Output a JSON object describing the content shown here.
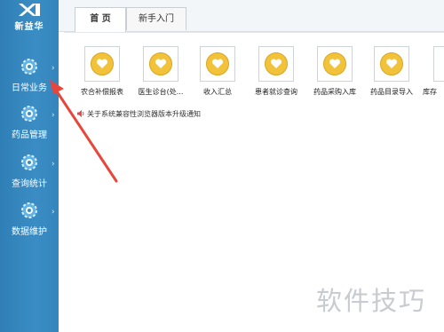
{
  "brand": {
    "name": "新益华"
  },
  "sidebar": {
    "items": [
      {
        "label": "日常业务",
        "icon": "gear-globe-icon"
      },
      {
        "label": "药品管理",
        "icon": "gear-globe-icon"
      },
      {
        "label": "查询统计",
        "icon": "gear-globe-icon"
      },
      {
        "label": "数据维护",
        "icon": "gear-globe-icon"
      }
    ]
  },
  "tabs": [
    {
      "label": "首 页",
      "active": true
    },
    {
      "label": "新手入门",
      "active": false
    }
  ],
  "shortcuts": [
    {
      "label": "农合补偿报表"
    },
    {
      "label": "医生诊台(处..."
    },
    {
      "label": "收入汇总"
    },
    {
      "label": "患者就诊查询"
    },
    {
      "label": "药品采购入库"
    },
    {
      "label": "药品目录导入"
    },
    {
      "label": "库存"
    }
  ],
  "notice": {
    "text": "关于系统兼容性浏览器版本升级通知"
  },
  "watermark": {
    "text": "软件技巧"
  },
  "colors": {
    "sidebar": "#3a8dc4",
    "icon_gold": "#f1c23a",
    "annotation_arrow": "#e8463b"
  }
}
